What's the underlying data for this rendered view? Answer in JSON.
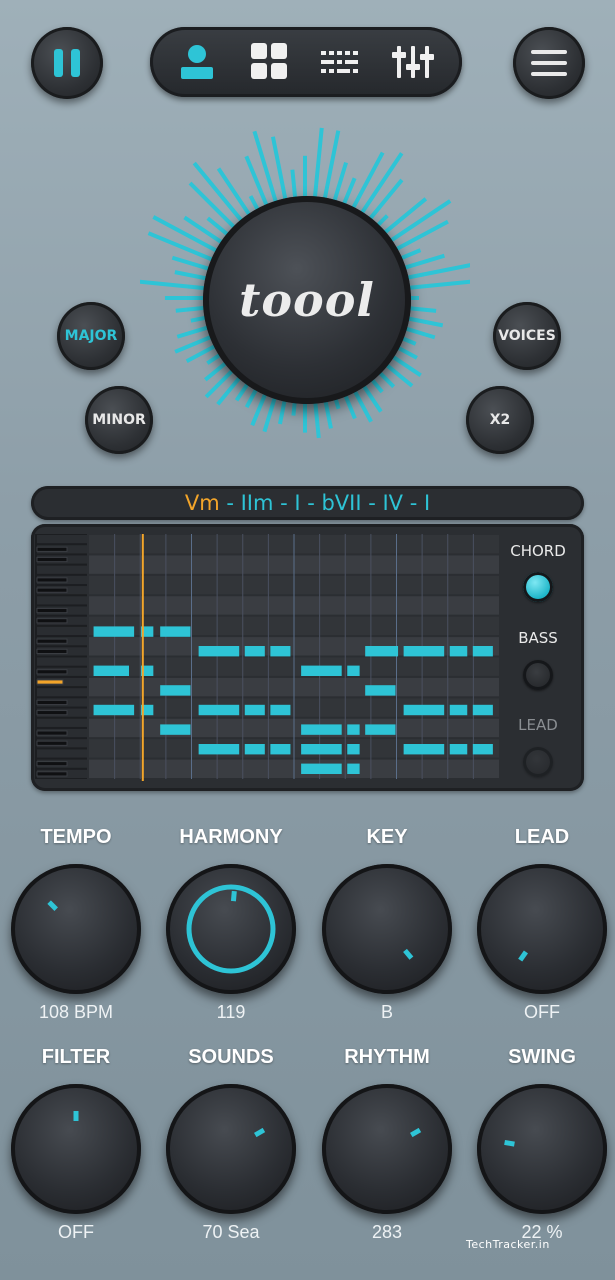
{
  "app": {
    "logo_text": "toool"
  },
  "nav": {
    "pause_icon": "pause-icon",
    "tabs": [
      {
        "icon": "user-icon",
        "active": true
      },
      {
        "icon": "grid-icon",
        "active": false
      },
      {
        "icon": "pattern-icon",
        "active": false
      },
      {
        "icon": "sliders-icon",
        "active": false
      }
    ],
    "menu_icon": "menu-icon"
  },
  "mode_buttons": {
    "major": "MAJOR",
    "minor": "MINOR",
    "voices": "VOICES",
    "x2": "X2"
  },
  "progression": {
    "current": "Vm",
    "rest": " - IIm - I - bVII - IV - I"
  },
  "sequencer_sides": {
    "chord_label": "CHORD",
    "bass_label": "BASS",
    "lead_label": "LEAD",
    "chord_on": true,
    "bass_on": false,
    "lead_on": false
  },
  "knobs": [
    {
      "title": "TEMPO",
      "value": "108 BPM",
      "indicator_angle": -45,
      "ring": false
    },
    {
      "title": "HARMONY",
      "value": "119",
      "indicator_angle": 5,
      "ring": true
    },
    {
      "title": "KEY",
      "value": "B",
      "indicator_angle": 140,
      "ring": false
    },
    {
      "title": "LEAD",
      "value": "OFF",
      "indicator_angle": -145,
      "ring": false
    },
    {
      "title": "FILTER",
      "value": "OFF",
      "indicator_angle": 0,
      "ring": false
    },
    {
      "title": "SOUNDS",
      "value": "70 Sea",
      "indicator_angle": 60,
      "ring": false
    },
    {
      "title": "RHYTHM",
      "value": "283",
      "indicator_angle": 60,
      "ring": false
    },
    {
      "title": "SWING",
      "value": "22 %",
      "indicator_angle": -80,
      "ring": false
    }
  ],
  "colors": {
    "accent": "#2ec4d6",
    "highlight": "#f3a52a",
    "panel": "#2b2e32"
  },
  "watermark": "TechTracker.in"
}
